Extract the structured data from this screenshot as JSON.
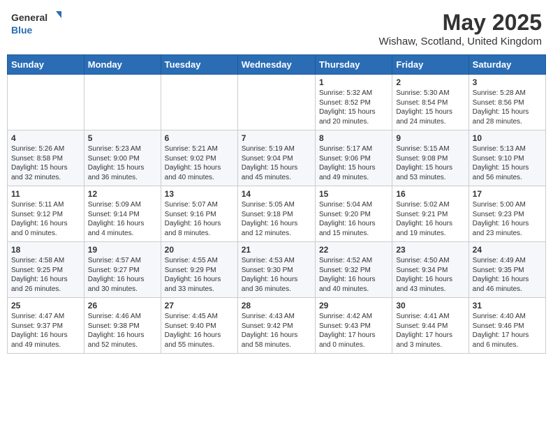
{
  "header": {
    "logo_general": "General",
    "logo_blue": "Blue",
    "month_title": "May 2025",
    "location": "Wishaw, Scotland, United Kingdom"
  },
  "days_of_week": [
    "Sunday",
    "Monday",
    "Tuesday",
    "Wednesday",
    "Thursday",
    "Friday",
    "Saturday"
  ],
  "weeks": [
    [
      {
        "day": "",
        "info": ""
      },
      {
        "day": "",
        "info": ""
      },
      {
        "day": "",
        "info": ""
      },
      {
        "day": "",
        "info": ""
      },
      {
        "day": "1",
        "info": "Sunrise: 5:32 AM\nSunset: 8:52 PM\nDaylight: 15 hours\nand 20 minutes."
      },
      {
        "day": "2",
        "info": "Sunrise: 5:30 AM\nSunset: 8:54 PM\nDaylight: 15 hours\nand 24 minutes."
      },
      {
        "day": "3",
        "info": "Sunrise: 5:28 AM\nSunset: 8:56 PM\nDaylight: 15 hours\nand 28 minutes."
      }
    ],
    [
      {
        "day": "4",
        "info": "Sunrise: 5:26 AM\nSunset: 8:58 PM\nDaylight: 15 hours\nand 32 minutes."
      },
      {
        "day": "5",
        "info": "Sunrise: 5:23 AM\nSunset: 9:00 PM\nDaylight: 15 hours\nand 36 minutes."
      },
      {
        "day": "6",
        "info": "Sunrise: 5:21 AM\nSunset: 9:02 PM\nDaylight: 15 hours\nand 40 minutes."
      },
      {
        "day": "7",
        "info": "Sunrise: 5:19 AM\nSunset: 9:04 PM\nDaylight: 15 hours\nand 45 minutes."
      },
      {
        "day": "8",
        "info": "Sunrise: 5:17 AM\nSunset: 9:06 PM\nDaylight: 15 hours\nand 49 minutes."
      },
      {
        "day": "9",
        "info": "Sunrise: 5:15 AM\nSunset: 9:08 PM\nDaylight: 15 hours\nand 53 minutes."
      },
      {
        "day": "10",
        "info": "Sunrise: 5:13 AM\nSunset: 9:10 PM\nDaylight: 15 hours\nand 56 minutes."
      }
    ],
    [
      {
        "day": "11",
        "info": "Sunrise: 5:11 AM\nSunset: 9:12 PM\nDaylight: 16 hours\nand 0 minutes."
      },
      {
        "day": "12",
        "info": "Sunrise: 5:09 AM\nSunset: 9:14 PM\nDaylight: 16 hours\nand 4 minutes."
      },
      {
        "day": "13",
        "info": "Sunrise: 5:07 AM\nSunset: 9:16 PM\nDaylight: 16 hours\nand 8 minutes."
      },
      {
        "day": "14",
        "info": "Sunrise: 5:05 AM\nSunset: 9:18 PM\nDaylight: 16 hours\nand 12 minutes."
      },
      {
        "day": "15",
        "info": "Sunrise: 5:04 AM\nSunset: 9:20 PM\nDaylight: 16 hours\nand 15 minutes."
      },
      {
        "day": "16",
        "info": "Sunrise: 5:02 AM\nSunset: 9:21 PM\nDaylight: 16 hours\nand 19 minutes."
      },
      {
        "day": "17",
        "info": "Sunrise: 5:00 AM\nSunset: 9:23 PM\nDaylight: 16 hours\nand 23 minutes."
      }
    ],
    [
      {
        "day": "18",
        "info": "Sunrise: 4:58 AM\nSunset: 9:25 PM\nDaylight: 16 hours\nand 26 minutes."
      },
      {
        "day": "19",
        "info": "Sunrise: 4:57 AM\nSunset: 9:27 PM\nDaylight: 16 hours\nand 30 minutes."
      },
      {
        "day": "20",
        "info": "Sunrise: 4:55 AM\nSunset: 9:29 PM\nDaylight: 16 hours\nand 33 minutes."
      },
      {
        "day": "21",
        "info": "Sunrise: 4:53 AM\nSunset: 9:30 PM\nDaylight: 16 hours\nand 36 minutes."
      },
      {
        "day": "22",
        "info": "Sunrise: 4:52 AM\nSunset: 9:32 PM\nDaylight: 16 hours\nand 40 minutes."
      },
      {
        "day": "23",
        "info": "Sunrise: 4:50 AM\nSunset: 9:34 PM\nDaylight: 16 hours\nand 43 minutes."
      },
      {
        "day": "24",
        "info": "Sunrise: 4:49 AM\nSunset: 9:35 PM\nDaylight: 16 hours\nand 46 minutes."
      }
    ],
    [
      {
        "day": "25",
        "info": "Sunrise: 4:47 AM\nSunset: 9:37 PM\nDaylight: 16 hours\nand 49 minutes."
      },
      {
        "day": "26",
        "info": "Sunrise: 4:46 AM\nSunset: 9:38 PM\nDaylight: 16 hours\nand 52 minutes."
      },
      {
        "day": "27",
        "info": "Sunrise: 4:45 AM\nSunset: 9:40 PM\nDaylight: 16 hours\nand 55 minutes."
      },
      {
        "day": "28",
        "info": "Sunrise: 4:43 AM\nSunset: 9:42 PM\nDaylight: 16 hours\nand 58 minutes."
      },
      {
        "day": "29",
        "info": "Sunrise: 4:42 AM\nSunset: 9:43 PM\nDaylight: 17 hours\nand 0 minutes."
      },
      {
        "day": "30",
        "info": "Sunrise: 4:41 AM\nSunset: 9:44 PM\nDaylight: 17 hours\nand 3 minutes."
      },
      {
        "day": "31",
        "info": "Sunrise: 4:40 AM\nSunset: 9:46 PM\nDaylight: 17 hours\nand 6 minutes."
      }
    ]
  ]
}
